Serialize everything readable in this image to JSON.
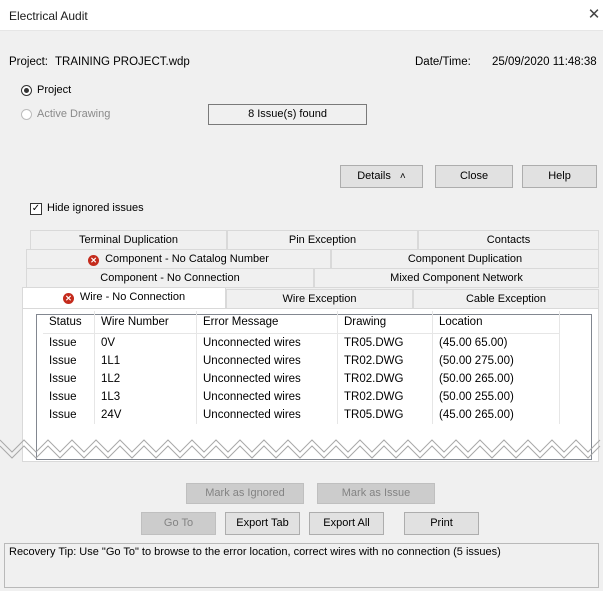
{
  "window": {
    "title": "Electrical Audit",
    "close_glyph": "✕"
  },
  "header": {
    "project_label": "Project:",
    "project_value": "TRAINING PROJECT.wdp",
    "datetime_label": "Date/Time:",
    "datetime_value": "25/09/2020 11:48:38"
  },
  "scope": {
    "project_option": "Project",
    "active_drawing_option": "Active Drawing",
    "selected": "Project"
  },
  "issues_found": "8 Issue(s) found",
  "buttons": {
    "details": "Details",
    "details_icon": "chevron-double-up-icon",
    "close": "Close",
    "help": "Help",
    "mark_ignored": "Mark as Ignored",
    "mark_issue": "Mark as Issue",
    "go_to": "Go To",
    "export_tab": "Export Tab",
    "export_all": "Export All",
    "print": "Print"
  },
  "hide_ignored": {
    "label": "Hide ignored issues",
    "checked": true
  },
  "tabs": {
    "row1": [
      "Terminal Duplication",
      "Pin Exception",
      "Contacts"
    ],
    "row2": [
      "Component - No Catalog Number",
      "Component Duplication"
    ],
    "row3": [
      "Component - No Connection",
      "Mixed Component Network"
    ],
    "row4": [
      "Wire - No Connection",
      "Wire Exception",
      "Cable Exception"
    ],
    "active": "Wire - No Connection"
  },
  "table": {
    "columns": [
      "Status",
      "Wire Number",
      "Error Message",
      "Drawing",
      "Location"
    ],
    "rows": [
      [
        "Issue",
        "0V",
        "Unconnected wires",
        "TR05.DWG",
        "(45.00 65.00)"
      ],
      [
        "Issue",
        "1L1",
        "Unconnected wires",
        "TR02.DWG",
        "(50.00 275.00)"
      ],
      [
        "Issue",
        "1L2",
        "Unconnected wires",
        "TR02.DWG",
        "(50.00 265.00)"
      ],
      [
        "Issue",
        "1L3",
        "Unconnected wires",
        "TR02.DWG",
        "(50.00 255.00)"
      ],
      [
        "Issue",
        "24V",
        "Unconnected wires",
        "TR05.DWG",
        "(45.00 265.00)"
      ]
    ]
  },
  "tip": "Recovery Tip: Use \"Go To\" to browse to the error location, correct wires with no connection (5 issues)",
  "colors": {
    "error_icon": "#c42b1c",
    "dialog_bg": "#f0f0f0",
    "button_bg": "#e1e1e1"
  }
}
